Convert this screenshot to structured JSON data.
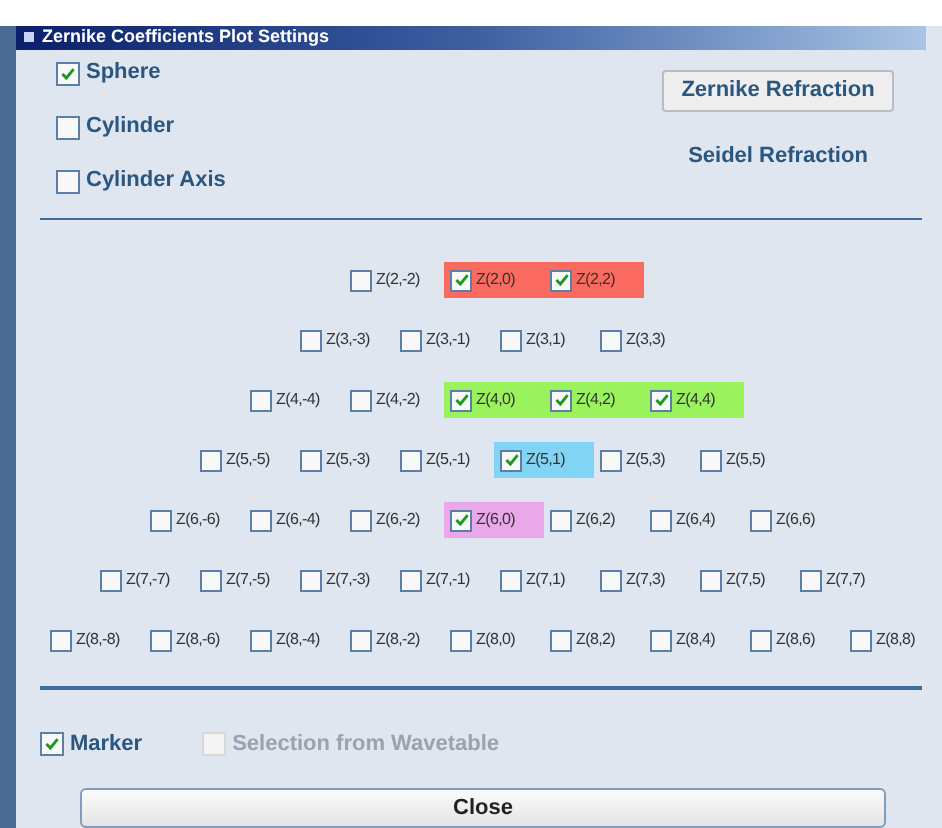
{
  "window": {
    "title": "Zernike Coefficients Plot Settings"
  },
  "options": [
    {
      "label": "Sphere",
      "checked": true
    },
    {
      "label": "Cylinder",
      "checked": false
    },
    {
      "label": "Cylinder Axis",
      "checked": false
    }
  ],
  "zernike_refraction_button": "Zernike Refraction",
  "seidel_refraction_label": "Seidel Refraction",
  "coefficient_rows": [
    [
      {
        "label": "Z(2,-2)",
        "checked": false
      },
      {
        "label": "Z(2,0)",
        "checked": true,
        "color": "#fa6a5f"
      },
      {
        "label": "Z(2,2)",
        "checked": true,
        "color": "#fa6a5f"
      }
    ],
    [
      {
        "label": "Z(3,-3)",
        "checked": false
      },
      {
        "label": "Z(3,-1)",
        "checked": false
      },
      {
        "label": "Z(3,1)",
        "checked": false
      },
      {
        "label": "Z(3,3)",
        "checked": false
      }
    ],
    [
      {
        "label": "Z(4,-4)",
        "checked": false
      },
      {
        "label": "Z(4,-2)",
        "checked": false
      },
      {
        "label": "Z(4,0)",
        "checked": true,
        "color": "#9af25c"
      },
      {
        "label": "Z(4,2)",
        "checked": true,
        "color": "#9af25c"
      },
      {
        "label": "Z(4,4)",
        "checked": true,
        "color": "#9af25c"
      }
    ],
    [
      {
        "label": "Z(5,-5)",
        "checked": false
      },
      {
        "label": "Z(5,-3)",
        "checked": false
      },
      {
        "label": "Z(5,-1)",
        "checked": false
      },
      {
        "label": "Z(5,1)",
        "checked": true,
        "color": "#82d4f4"
      },
      {
        "label": "Z(5,3)",
        "checked": false
      },
      {
        "label": "Z(5,5)",
        "checked": false
      }
    ],
    [
      {
        "label": "Z(6,-6)",
        "checked": false
      },
      {
        "label": "Z(6,-4)",
        "checked": false
      },
      {
        "label": "Z(6,-2)",
        "checked": false
      },
      {
        "label": "Z(6,0)",
        "checked": true,
        "color": "#eaa8ea"
      },
      {
        "label": "Z(6,2)",
        "checked": false
      },
      {
        "label": "Z(6,4)",
        "checked": false
      },
      {
        "label": "Z(6,6)",
        "checked": false
      }
    ],
    [
      {
        "label": "Z(7,-7)",
        "checked": false
      },
      {
        "label": "Z(7,-5)",
        "checked": false
      },
      {
        "label": "Z(7,-3)",
        "checked": false
      },
      {
        "label": "Z(7,-1)",
        "checked": false
      },
      {
        "label": "Z(7,1)",
        "checked": false
      },
      {
        "label": "Z(7,3)",
        "checked": false
      },
      {
        "label": "Z(7,5)",
        "checked": false
      },
      {
        "label": "Z(7,7)",
        "checked": false
      }
    ],
    [
      {
        "label": "Z(8,-8)",
        "checked": false
      },
      {
        "label": "Z(8,-6)",
        "checked": false
      },
      {
        "label": "Z(8,-4)",
        "checked": false
      },
      {
        "label": "Z(8,-2)",
        "checked": false
      },
      {
        "label": "Z(8,0)",
        "checked": false
      },
      {
        "label": "Z(8,2)",
        "checked": false
      },
      {
        "label": "Z(8,4)",
        "checked": false
      },
      {
        "label": "Z(8,6)",
        "checked": false
      },
      {
        "label": "Z(8,8)",
        "checked": false
      }
    ]
  ],
  "bottom_options": [
    {
      "label": "Marker",
      "checked": true,
      "disabled": false
    },
    {
      "label": "Selection from Wavetable",
      "checked": false,
      "disabled": true
    }
  ],
  "close_button": "Close"
}
